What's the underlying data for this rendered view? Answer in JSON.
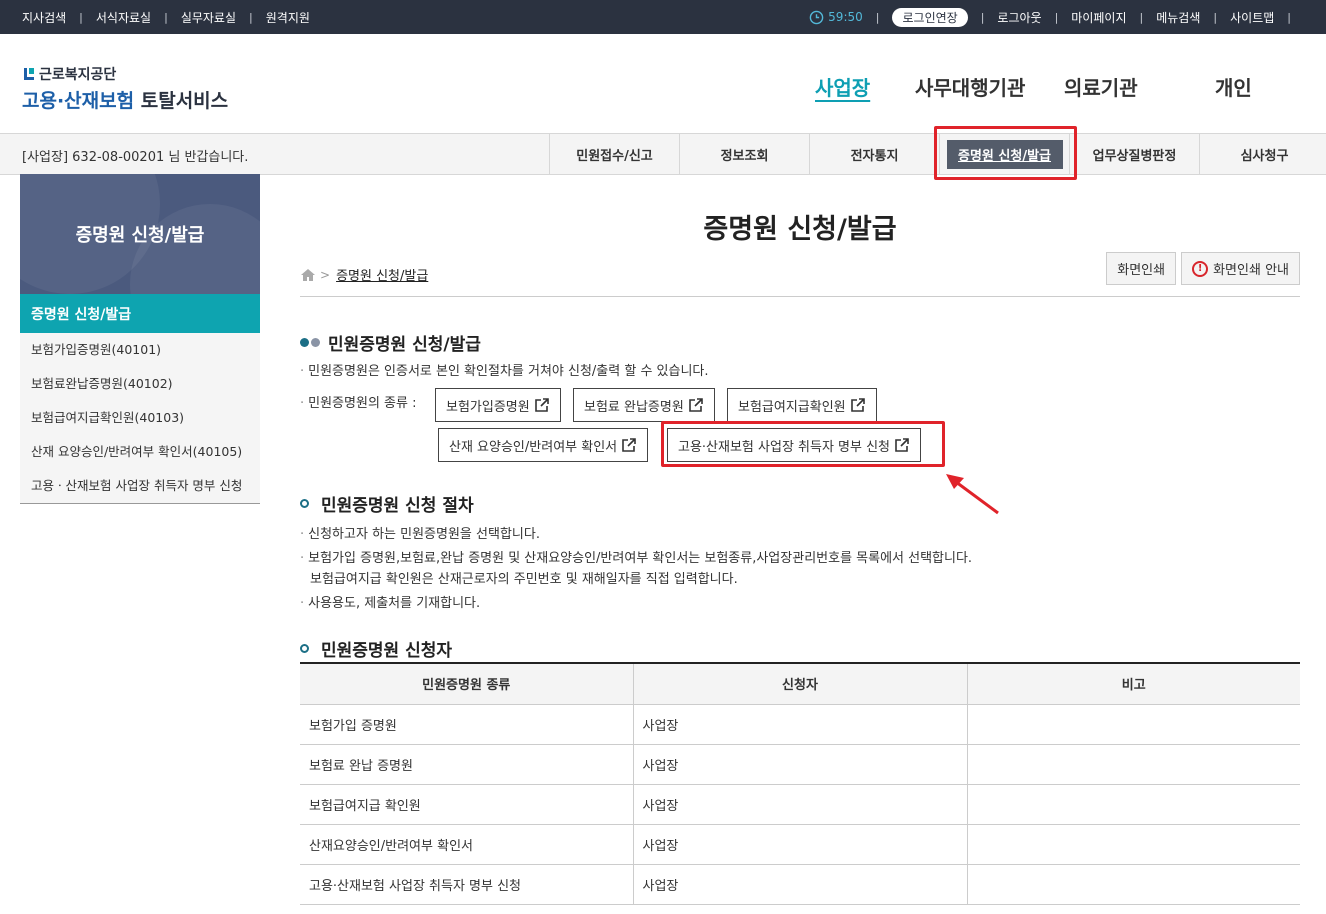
{
  "topbar": {
    "left_links": [
      "지사검색",
      "서식자료실",
      "실무자료실",
      "원격지원"
    ],
    "timer": "59:50",
    "login_extend": "로그인연장",
    "right_links": [
      "로그아웃",
      "마이페이지",
      "메뉴검색",
      "사이트맵"
    ]
  },
  "header": {
    "agency": "근로복지공단",
    "service_blue": "고용·산재보험",
    "service_dark": "토탈서비스",
    "gnb": [
      "사업장",
      "사무대행기관",
      "의료기관",
      "개인"
    ]
  },
  "subnav": {
    "welcome": "[사업장] 632-08-00201 님 반갑습니다.",
    "tabs": [
      "민원접수/신고",
      "정보조회",
      "전자통지",
      "증명원 신청/발급",
      "업무상질병판정",
      "심사청구"
    ]
  },
  "lnb": {
    "title": "증명원 신청/발급",
    "active": "증명원 신청/발급",
    "items": [
      "보험가입증명원(40101)",
      "보험료완납증명원(40102)",
      "보험급여지급확인원(40103)",
      "산재 요양승인/반려여부 확인서(40105)",
      "고용ㆍ산재보험 사업장 취득자 명부 신청"
    ]
  },
  "main": {
    "title": "증명원 신청/발급",
    "breadcrumb": "증명원 신청/발급",
    "print": "화면인쇄",
    "print_guide": "화면인쇄 안내",
    "section1": {
      "title": "민원증명원 신청/발급",
      "desc": "민원증명원은 인증서로 본인 확인절차를 거쳐야 신청/출력 할 수 있습니다.",
      "types_label": "민원증명원의 종류 :",
      "buttons": [
        "보험가입증명원",
        "보험료 완납증명원",
        "보험급여지급확인원",
        "산재 요양승인/반려여부 확인서",
        "고용·산재보험 사업장 취득자 명부 신청"
      ]
    },
    "section2": {
      "title": "민원증명원 신청 절차",
      "steps": [
        "신청하고자 하는 민원증명원을 선택합니다.",
        "보험가입 증명원,보험료,완납 증명원 및 산재요양승인/반려여부 확인서는 보험종류,사업장관리번호를 목록에서 선택합니다.",
        "보험급여지급 확인원은 산재근로자의 주민번호 및 재해일자를 직접 입력합니다.",
        "사용용도, 제출처를 기재합니다."
      ]
    },
    "section3": {
      "title": "민원증명원 신청자",
      "headers": [
        "민원증명원 종류",
        "신청자",
        "비고"
      ],
      "rows": [
        [
          "보험가입 증명원",
          "사업장",
          ""
        ],
        [
          "보험료 완납 증명원",
          "사업장",
          ""
        ],
        [
          "보험급여지급 확인원",
          "사업장",
          ""
        ],
        [
          "산재요양승인/반려여부 확인서",
          "사업장",
          ""
        ],
        [
          "고용·산재보험 사업장 취득자 명부 신청",
          "사업장",
          ""
        ]
      ]
    }
  },
  "colors": {
    "accent": "#0ea4b0",
    "highlight": "#e0232a",
    "topbar": "#2b3240"
  }
}
